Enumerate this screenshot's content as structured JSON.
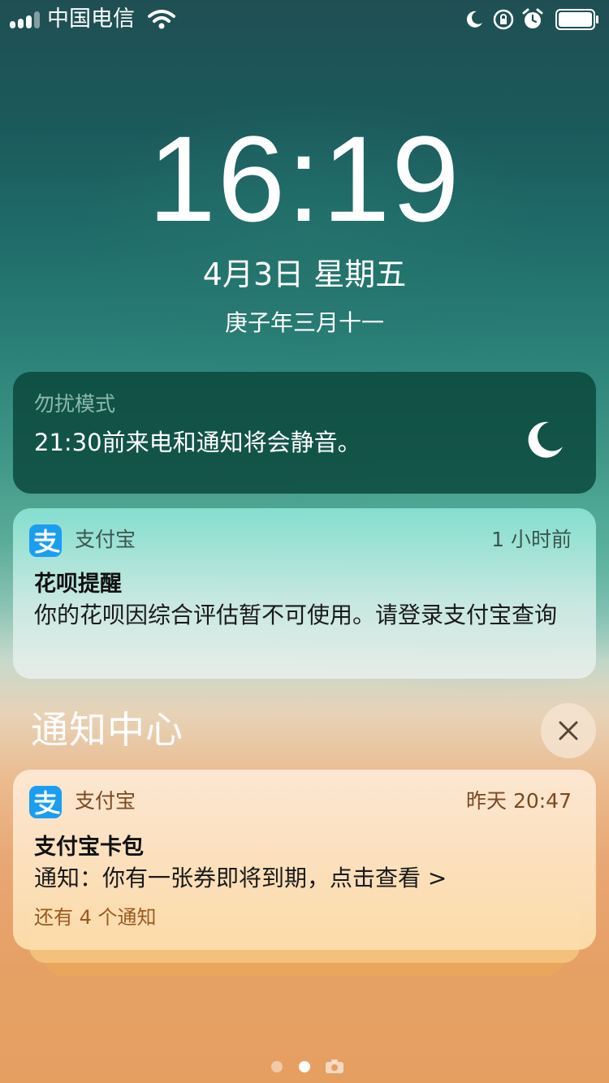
{
  "status_bar": {
    "carrier": "中国电信",
    "signal_bars": 4,
    "icons": [
      "signal-icon",
      "wifi-icon",
      "moon-icon",
      "orientation-lock-icon",
      "alarm-icon",
      "battery-icon"
    ]
  },
  "lock_screen": {
    "time": "16:19",
    "date": "4月3日 星期五",
    "lunar_date": "庚子年三月十一"
  },
  "do_not_disturb": {
    "title": "勿扰模式",
    "message": "21:30前来电和通知将会静音。",
    "icon": "moon-icon"
  },
  "notifications": [
    {
      "app": "支付宝",
      "time": "1 小时前",
      "title": "花呗提醒",
      "body": "你的花呗因综合评估暂不可使用。请登录支付宝查询",
      "icon": "alipay-icon"
    }
  ],
  "notification_center": {
    "title": "通知中心",
    "close_icon": "close-icon",
    "grouped": {
      "app": "支付宝",
      "time": "昨天 20:47",
      "title": "支付宝卡包",
      "body": "通知：你有一张券即将到期，点击查看 >",
      "more": "还有 4 个通知",
      "icon": "alipay-icon"
    }
  },
  "page_indicator": {
    "pages": 2,
    "current": 2,
    "extra_icon": "camera-icon"
  },
  "colors": {
    "alipay_blue": "#1b9ef0",
    "dnd_card": "#0a463a"
  }
}
